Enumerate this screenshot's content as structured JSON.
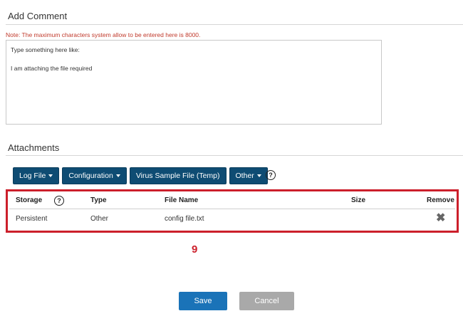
{
  "comment": {
    "title": "Add Comment",
    "note": "Note: The maximum characters system allow to be entered here is 8000.",
    "text": "Type something here like:\n\nI am attaching the file required"
  },
  "attachments": {
    "title": "Attachments",
    "buttons": [
      "Log File",
      "Configuration",
      "Virus Sample File (Temp)",
      "Other"
    ],
    "help_glyph": "?",
    "columns": {
      "storage": "Storage",
      "type": "Type",
      "file_name": "File Name",
      "size": "Size",
      "remove": "Remove"
    },
    "rows": [
      {
        "storage": "Persistent",
        "type": "Other",
        "file_name": "config file.txt",
        "size": ""
      }
    ],
    "remove_glyph": "✖"
  },
  "annotation": {
    "step_number": "9",
    "color": "#cc1f2b"
  },
  "footer": {
    "save_label": "Save",
    "cancel_label": "Cancel"
  },
  "colors": {
    "primary_button": "#0e4c73",
    "save_button": "#1a73b8",
    "cancel_button": "#a9a9a9",
    "note_text": "#c0392b"
  }
}
